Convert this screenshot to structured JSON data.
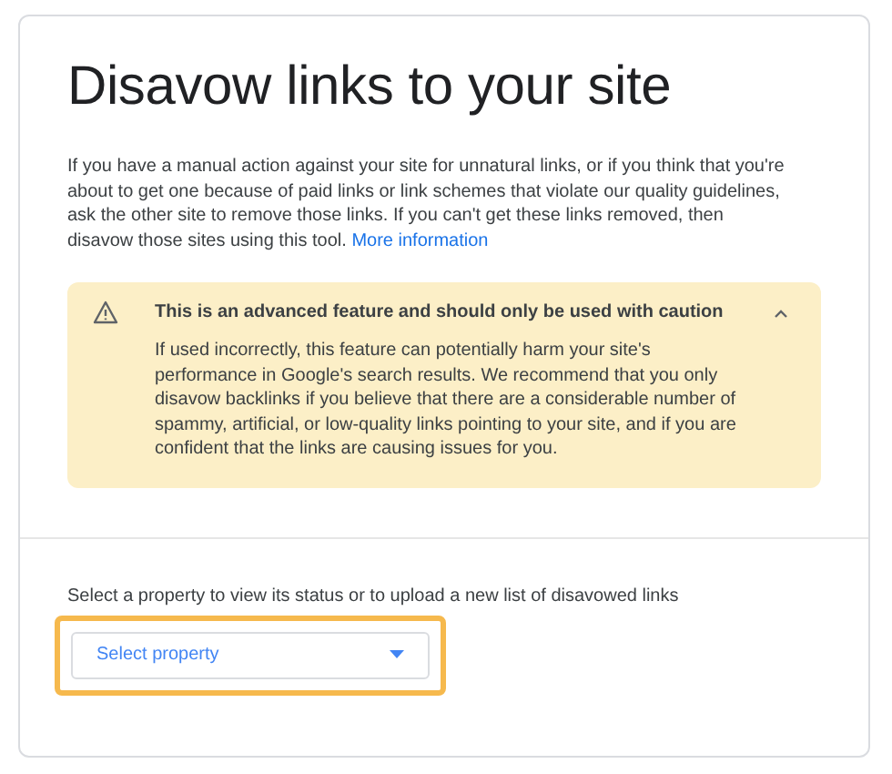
{
  "page": {
    "title": "Disavow links to your site",
    "intro": "If you have a manual action against your site for unnatural links, or if you think that you're about to get one because of paid links or link schemes that violate our quality guidelines, ask the other site to remove those links. If you can't get these links removed, then disavow those sites using this tool.",
    "intro_link": "More information"
  },
  "warning": {
    "title": "This is an advanced feature and should only be used with caution",
    "expanded": true,
    "body": "If used incorrectly, this feature can potentially harm your site's performance in Google's search results. We recommend that you only disavow backlinks if you believe that there are a considerable number of spammy, artificial, or low-quality links pointing to your site, and if you are confident that the links are causing issues for you."
  },
  "property": {
    "label": "Select a property to view its status or to upload a new list of disavowed links",
    "placeholder": "Select property",
    "highlighted": true
  }
}
